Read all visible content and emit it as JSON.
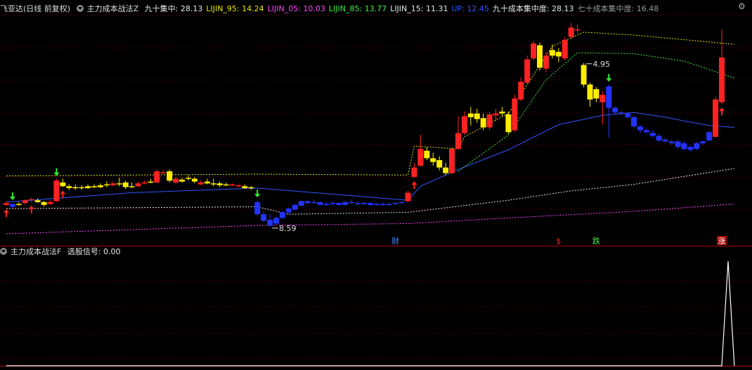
{
  "header": {
    "stock": "飞亚达(日线 前复权)",
    "indicator": "主力成本战法Z",
    "items": [
      {
        "label": "九十集中: 28.13",
        "color": "#e8e8e8"
      },
      {
        "label": "LIJIN_95: 14.24",
        "color": "#e6e600"
      },
      {
        "label": "LIJIN_05: 10.03",
        "color": "#ff44ff"
      },
      {
        "label": "LIJIN_85: 13.77",
        "color": "#44ee44"
      },
      {
        "label": "LIJIN_15: 11.31",
        "color": "#e8e8e8"
      },
      {
        "label": "UP: 12.45",
        "color": "#3355ff"
      },
      {
        "label": "九十成本集中度: 28.13",
        "color": "#e8e8e8"
      },
      {
        "label": "七十成本集中度: 16.48",
        "color": "#999999"
      }
    ]
  },
  "sub_header": {
    "indicator": "主力成本战法F",
    "items": [
      {
        "label": "选股信号: 0.00",
        "color": "#e8e8e8"
      }
    ]
  },
  "icons": {
    "settings": "settings-icon",
    "collapse": "collapse-triangle-icon"
  },
  "colors": {
    "up": "#ff2222",
    "down": "#2233ff",
    "flat": "#ffee00",
    "grid": "#7a0000",
    "axis": "#b00000"
  },
  "annotations": {
    "high_label": "4.95",
    "low_label": "8.59"
  },
  "markers": [
    {
      "text": "财",
      "color": "#4488ff"
    },
    {
      "text": "$",
      "color": "#ff2222"
    },
    {
      "text": "跌",
      "color": "#44ee44"
    },
    {
      "text": "涨",
      "color": "#ffffff",
      "bg": "#aa0000"
    }
  ],
  "chart_data": [
    {
      "type": "candlestick",
      "title": "飞亚达(日线 前复权)",
      "y_range": [
        7.6,
        31.0
      ],
      "candles": [
        [
          11.2,
          11.0,
          11.4,
          10.9,
          "up"
        ],
        [
          11.1,
          10.8,
          11.2,
          10.7,
          "down"
        ],
        [
          11.0,
          11.1,
          11.3,
          10.9,
          "flat"
        ],
        [
          11.2,
          11.5,
          11.6,
          11.0,
          "up"
        ],
        [
          11.5,
          11.6,
          11.8,
          11.3,
          "up"
        ],
        [
          11.5,
          11.3,
          11.7,
          11.2,
          "flat"
        ],
        [
          11.3,
          11.0,
          11.4,
          10.8,
          "flat"
        ],
        [
          11.1,
          11.3,
          11.5,
          11.0,
          "up"
        ],
        [
          11.4,
          13.6,
          13.8,
          11.3,
          "up"
        ],
        [
          13.4,
          13.0,
          13.8,
          12.9,
          "flat"
        ],
        [
          13.0,
          12.8,
          13.2,
          12.6,
          "flat"
        ],
        [
          12.8,
          12.9,
          13.2,
          12.6,
          "flat"
        ],
        [
          12.9,
          12.8,
          13.1,
          12.6,
          "flat"
        ],
        [
          12.8,
          13.0,
          13.2,
          12.7,
          "flat"
        ],
        [
          13.0,
          12.9,
          13.2,
          12.8,
          "flat"
        ],
        [
          12.9,
          13.1,
          13.3,
          12.8,
          "flat"
        ],
        [
          13.1,
          13.2,
          13.5,
          12.9,
          "flat"
        ],
        [
          13.1,
          13.3,
          13.5,
          13.0,
          "up"
        ],
        [
          13.3,
          13.2,
          13.9,
          13.0,
          "flat"
        ],
        [
          13.4,
          12.9,
          13.6,
          12.7,
          "flat"
        ],
        [
          12.9,
          13.0,
          13.4,
          12.8,
          "flat"
        ],
        [
          13.0,
          13.3,
          13.5,
          12.9,
          "up"
        ],
        [
          13.3,
          13.4,
          13.6,
          13.2,
          "up"
        ],
        [
          13.4,
          13.5,
          13.8,
          13.3,
          "flat"
        ],
        [
          13.4,
          14.6,
          14.8,
          13.3,
          "up"
        ],
        [
          14.5,
          14.5,
          14.7,
          14.3,
          "up"
        ],
        [
          14.6,
          13.6,
          14.8,
          13.4,
          "flat"
        ],
        [
          13.8,
          13.4,
          14.0,
          13.2,
          "up"
        ],
        [
          13.5,
          13.7,
          13.9,
          13.4,
          "flat"
        ],
        [
          13.8,
          13.9,
          14.2,
          13.6,
          "flat"
        ],
        [
          13.8,
          13.5,
          14.0,
          13.3,
          "flat"
        ],
        [
          13.4,
          13.2,
          13.7,
          13.1,
          "up"
        ],
        [
          13.3,
          13.5,
          13.8,
          13.2,
          "flat"
        ],
        [
          13.3,
          13.3,
          13.8,
          13.0,
          "flat"
        ],
        [
          13.3,
          13.1,
          13.5,
          12.9,
          "flat"
        ],
        [
          13.1,
          13.2,
          13.4,
          13.0,
          "flat"
        ],
        [
          13.2,
          13.1,
          13.3,
          13.0,
          "up"
        ],
        [
          13.1,
          13.0,
          13.2,
          12.9,
          "up"
        ],
        [
          13.0,
          12.8,
          13.2,
          12.7,
          "flat"
        ],
        [
          12.9,
          12.8,
          13.0,
          12.6,
          "flat"
        ],
        [
          11.3,
          10.0,
          11.5,
          9.8,
          "down"
        ],
        [
          10.0,
          9.3,
          10.3,
          9.1,
          "down"
        ],
        [
          9.4,
          8.8,
          10.0,
          8.59,
          "down"
        ],
        [
          9.0,
          9.6,
          9.8,
          8.9,
          "down"
        ],
        [
          9.6,
          10.2,
          10.3,
          9.5,
          "down"
        ],
        [
          10.2,
          10.6,
          10.7,
          10.0,
          "down"
        ],
        [
          10.5,
          11.0,
          11.1,
          10.4,
          "down"
        ],
        [
          10.9,
          11.4,
          11.5,
          10.8,
          "down"
        ],
        [
          11.4,
          11.2,
          11.5,
          11.0,
          "down"
        ],
        [
          11.2,
          11.3,
          11.6,
          11.1,
          "down"
        ],
        [
          11.3,
          11.0,
          11.4,
          10.9,
          "down"
        ],
        [
          11.0,
          11.1,
          11.3,
          10.9,
          "down"
        ],
        [
          11.1,
          11.2,
          11.4,
          11.0,
          "down"
        ],
        [
          11.2,
          11.0,
          11.3,
          10.9,
          "down"
        ],
        [
          11.0,
          11.3,
          11.5,
          10.9,
          "down"
        ],
        [
          11.3,
          11.2,
          11.6,
          11.1,
          "down"
        ],
        [
          11.2,
          11.1,
          11.4,
          11.0,
          "down"
        ],
        [
          11.1,
          11.2,
          11.3,
          11.0,
          "down"
        ],
        [
          11.2,
          11.0,
          11.3,
          10.9,
          "down"
        ],
        [
          11.0,
          11.1,
          11.2,
          10.9,
          "down"
        ],
        [
          11.1,
          11.0,
          11.3,
          10.9,
          "down"
        ],
        [
          11.0,
          11.1,
          11.2,
          10.9,
          "down"
        ],
        [
          11.1,
          11.2,
          11.3,
          11.0,
          "down"
        ],
        [
          11.2,
          11.3,
          11.4,
          11.1,
          "down"
        ],
        [
          11.4,
          12.3,
          12.5,
          11.3,
          "up"
        ],
        [
          14.0,
          15.0,
          15.5,
          13.9,
          "up"
        ],
        [
          15.2,
          17.0,
          18.5,
          15.1,
          "up"
        ],
        [
          16.8,
          16.0,
          17.2,
          15.8,
          "flat"
        ],
        [
          16.0,
          15.6,
          16.6,
          15.2,
          "flat"
        ],
        [
          15.8,
          15.0,
          16.2,
          14.7,
          "flat"
        ],
        [
          15.0,
          14.4,
          15.5,
          14.2,
          "flat"
        ],
        [
          14.4,
          17.0,
          17.2,
          14.3,
          "up"
        ],
        [
          17.0,
          18.7,
          20.5,
          16.9,
          "up"
        ],
        [
          18.7,
          20.5,
          21.0,
          18.5,
          "up"
        ],
        [
          20.4,
          20.8,
          21.5,
          19.5,
          "flat"
        ],
        [
          20.8,
          20.2,
          21.3,
          19.8,
          "flat"
        ],
        [
          20.3,
          19.3,
          20.8,
          19.0,
          "flat"
        ],
        [
          19.3,
          20.7,
          21.0,
          19.0,
          "up"
        ],
        [
          20.6,
          20.8,
          21.3,
          20.0,
          "up"
        ],
        [
          20.8,
          21.0,
          21.5,
          20.5,
          "flat"
        ],
        [
          20.7,
          18.8,
          21.0,
          18.6,
          "flat"
        ],
        [
          19.0,
          22.4,
          22.8,
          18.8,
          "up"
        ],
        [
          22.3,
          24.2,
          24.7,
          22.1,
          "up"
        ],
        [
          24.1,
          26.6,
          27.0,
          24.0,
          "up"
        ],
        [
          26.7,
          28.3,
          28.6,
          26.5,
          "up"
        ],
        [
          28.1,
          25.7,
          28.4,
          25.4,
          "flat"
        ],
        [
          25.6,
          27.0,
          27.4,
          25.2,
          "up"
        ],
        [
          27.0,
          27.6,
          28.2,
          26.7,
          "flat"
        ],
        [
          27.4,
          26.9,
          27.8,
          26.3,
          "flat"
        ],
        [
          26.7,
          28.7,
          29.0,
          26.5,
          "up"
        ],
        [
          29.0,
          30.0,
          30.5,
          28.8,
          "up"
        ],
        [
          29.8,
          29.7,
          30.3,
          29.4,
          "up"
        ],
        [
          26.0,
          23.9,
          26.2,
          23.6,
          "flat"
        ],
        [
          23.9,
          22.3,
          24.1,
          21.5,
          "flat"
        ],
        [
          22.4,
          23.4,
          23.6,
          22.0,
          "flat"
        ],
        [
          22.8,
          22.0,
          23.2,
          19.6,
          "up"
        ],
        [
          23.7,
          21.4,
          23.9,
          18.2,
          "down"
        ],
        [
          21.4,
          20.9,
          21.6,
          20.7,
          "down"
        ],
        [
          20.9,
          20.8,
          21.1,
          20.6,
          "down"
        ],
        [
          20.8,
          20.4,
          21.0,
          20.2,
          "down"
        ],
        [
          20.4,
          19.4,
          20.6,
          19.2,
          "down"
        ],
        [
          19.4,
          19.0,
          19.6,
          18.7,
          "down"
        ],
        [
          19.0,
          18.8,
          19.2,
          18.6,
          "down"
        ],
        [
          18.7,
          18.4,
          19.0,
          18.2,
          "down"
        ],
        [
          18.4,
          17.9,
          18.6,
          17.7,
          "down"
        ],
        [
          18.0,
          17.8,
          18.2,
          17.6,
          "down"
        ],
        [
          17.8,
          17.6,
          18.0,
          17.4,
          "down"
        ],
        [
          17.8,
          17.2,
          18.0,
          17.0,
          "down"
        ],
        [
          17.6,
          17.0,
          17.8,
          16.8,
          "down"
        ],
        [
          17.2,
          16.9,
          17.4,
          16.7,
          "down"
        ],
        [
          17.0,
          17.6,
          17.8,
          16.9,
          "down"
        ],
        [
          17.6,
          17.8,
          17.9,
          17.4,
          "down"
        ],
        [
          17.9,
          18.8,
          19.0,
          17.8,
          "down"
        ],
        [
          18.3,
          22.3,
          22.6,
          18.2,
          "up"
        ],
        [
          22.0,
          26.8,
          29.8,
          21.8,
          "up"
        ]
      ],
      "series": [
        {
          "name": "UP",
          "color": "#3355ff",
          "style": "solid",
          "values": [
            [
              0,
              11.3
            ],
            [
              20,
              12.3
            ],
            [
              40,
              12.8
            ],
            [
              64,
              11.5
            ],
            [
              66,
              13.0
            ],
            [
              72,
              14.8
            ],
            [
              80,
              16.9
            ],
            [
              88,
              19.6
            ],
            [
              95,
              20.6
            ],
            [
              100,
              20.9
            ],
            [
              105,
              20.4
            ],
            [
              108,
              20.0
            ],
            [
              112,
              19.5
            ],
            [
              116,
              19.3
            ]
          ]
        },
        {
          "name": "LIJIN_95",
          "color": "#e6e600",
          "style": "dash",
          "values": [
            [
              0,
              14.1
            ],
            [
              20,
              14.2
            ],
            [
              40,
              14.3
            ],
            [
              64,
              14.2
            ],
            [
              65,
              17.3
            ],
            [
              72,
              17.0
            ],
            [
              73,
              18.3
            ],
            [
              80,
              20.8
            ],
            [
              87,
              28.0
            ],
            [
              92,
              29.5
            ],
            [
              100,
              29.2
            ],
            [
              116,
              28.2
            ]
          ]
        },
        {
          "name": "LIJIN_85",
          "color": "#44ee44",
          "style": "dash",
          "values": [
            [
              72,
              14.6
            ],
            [
              80,
              18.5
            ],
            [
              86,
              24.4
            ],
            [
              91,
              27.3
            ],
            [
              100,
              27.2
            ],
            [
              108,
              26.4
            ],
            [
              116,
              24.6
            ]
          ]
        },
        {
          "name": "LIJIN_15",
          "color": "#e8e8e8",
          "style": "dash",
          "values": [
            [
              0,
              10.6
            ],
            [
              40,
              10.8
            ],
            [
              45,
              10.0
            ],
            [
              64,
              10.2
            ],
            [
              80,
              11.5
            ],
            [
              90,
              12.5
            ],
            [
              100,
              13.2
            ],
            [
              116,
              14.9
            ]
          ]
        },
        {
          "name": "LIJIN_05",
          "color": "#ff44ff",
          "style": "dash",
          "values": [
            [
              0,
              7.9
            ],
            [
              40,
              8.8
            ],
            [
              64,
              9.0
            ],
            [
              80,
              9.6
            ],
            [
              100,
              10.3
            ],
            [
              116,
              11.1
            ]
          ]
        }
      ],
      "signal_arrows": [
        {
          "i": 0,
          "dir": "up",
          "color": "#ff2222"
        },
        {
          "i": 1,
          "dir": "down",
          "color": "#33ee33"
        },
        {
          "i": 4,
          "dir": "up",
          "color": "#ff2222"
        },
        {
          "i": 8,
          "dir": "down",
          "color": "#33ee33"
        },
        {
          "i": 9,
          "dir": "up",
          "color": "#ff2222"
        },
        {
          "i": 40,
          "dir": "down",
          "color": "#33ee33"
        },
        {
          "i": 65,
          "dir": "up",
          "color": "#ff2222"
        },
        {
          "i": 96,
          "dir": "down",
          "color": "#33ee33"
        },
        {
          "i": 114,
          "dir": "up",
          "color": "#ff2222"
        }
      ]
    },
    {
      "type": "line",
      "title": "主力成本战法F",
      "series": [
        {
          "name": "选股信号",
          "color": "#ffffff",
          "values": [
            [
              0,
              0
            ],
            [
              114,
              0
            ],
            [
              115,
              1
            ],
            [
              116,
              0
            ]
          ]
        }
      ],
      "y_range": [
        0,
        1
      ]
    }
  ]
}
